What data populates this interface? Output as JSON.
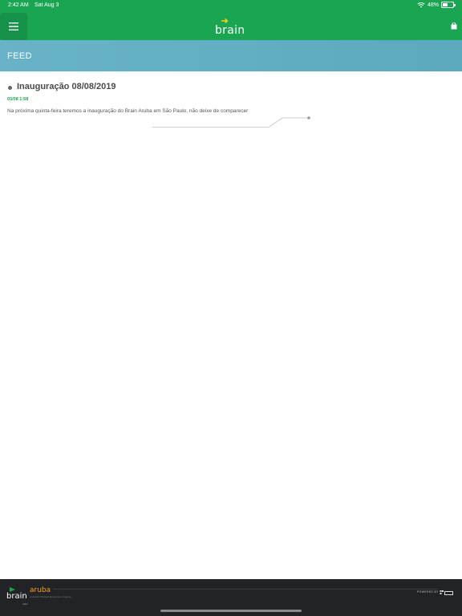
{
  "status_bar": {
    "time": "2:42 AM",
    "date": "Sat Aug 3",
    "battery": "48%",
    "battery_level": 0.48
  },
  "app_bar": {
    "brand": "brain",
    "menu_icon": "hamburger-menu-icon",
    "cart_icon": "shopping-bag-icon",
    "background_color": "#1aa553"
  },
  "section": {
    "title": "FEED",
    "background_color": "#64aec4"
  },
  "feed": {
    "posts": [
      {
        "title": "Inauguração 08/08/2019",
        "timestamp": "03/08 1:58",
        "body": "Na próxima quinta-feira teremos a inauguração do Brain Aruba em São Paulo, não deixe de comparecer"
      }
    ]
  },
  "footer": {
    "brand_left": "brain",
    "brand_left_sub": "Labs",
    "partner": "aruba",
    "partner_sub": "a Hewlett Packard Enterprise company",
    "powered_by": "POWERED BY",
    "powered_logo_icon": "hewlett-packard-logo-icon",
    "accent_color": "#f5a01a"
  }
}
